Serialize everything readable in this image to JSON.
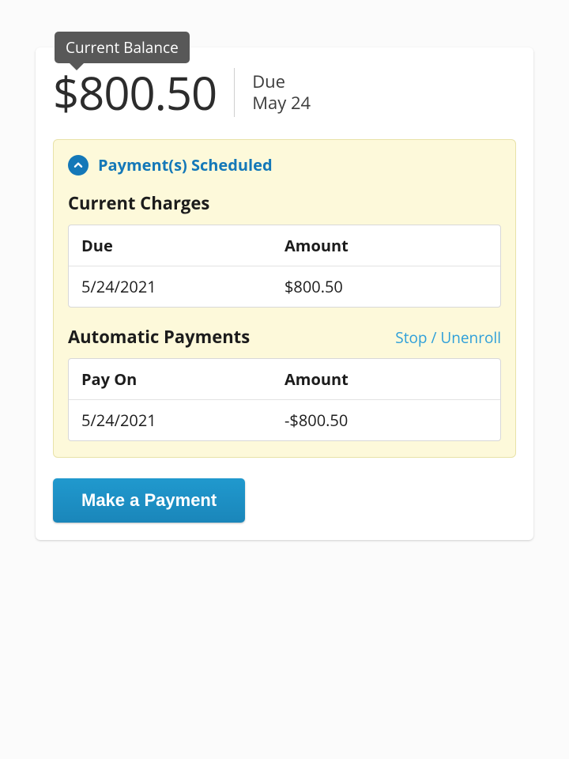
{
  "tooltip": {
    "label": "Current Balance"
  },
  "balance": {
    "amount": "$800.50",
    "due_label": "Due",
    "due_date": "May 24"
  },
  "scheduled_toggle": {
    "label": "Payment(s) Scheduled"
  },
  "current_charges": {
    "title": "Current Charges",
    "headers": {
      "due": "Due",
      "amount": "Amount"
    },
    "row": {
      "due": "5/24/2021",
      "amount": "$800.50"
    }
  },
  "auto_payments": {
    "title": "Automatic Payments",
    "action": "Stop / Unenroll",
    "headers": {
      "pay_on": "Pay On",
      "amount": "Amount"
    },
    "row": {
      "pay_on": "5/24/2021",
      "amount": "-$800.50"
    }
  },
  "buttons": {
    "make_payment": "Make a Payment"
  },
  "colors": {
    "accent": "#1478b8",
    "panel_bg": "#fdf9da",
    "link": "#2e9fd9"
  }
}
